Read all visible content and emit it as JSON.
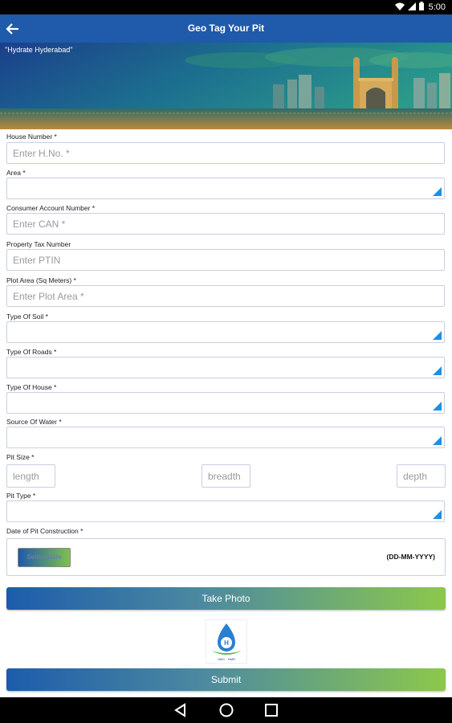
{
  "status": {
    "time": "5:00",
    "icons": [
      "wifi-icon",
      "signal-icon",
      "battery-icon"
    ]
  },
  "appbar": {
    "title": "Geo Tag Your Pit",
    "back_icon": "arrow-back-icon"
  },
  "banner": {
    "slogan": "\"Hydrate Hyderabad\""
  },
  "form": {
    "house_number": {
      "label": "House Number *",
      "placeholder": "Enter H.No. *"
    },
    "area": {
      "label": "Area *"
    },
    "can": {
      "label": "Consumer Account Number *",
      "placeholder": "Enter CAN *"
    },
    "ptin": {
      "label": "Property Tax Number",
      "placeholder": "Enter PTIN"
    },
    "plot_area": {
      "label": "Plot Area (Sq Meters) *",
      "placeholder": "Enter Plot Area *"
    },
    "soil": {
      "label": "Type Of Soil *"
    },
    "roads": {
      "label": "Type Of Roads *"
    },
    "house_type": {
      "label": "Type Of House *"
    },
    "water": {
      "label": "Source Of Water *"
    },
    "pit_size": {
      "label": "Pit Size *",
      "length": "length",
      "breadth": "breadth",
      "depth": "depth"
    },
    "pit_type": {
      "label": "Pit Type *"
    },
    "date": {
      "label": "Date of Pit Construction *",
      "button": "Select Date",
      "format": "(DD-MM-YYYY)"
    }
  },
  "actions": {
    "take_photo": "Take Photo",
    "submit": "Submit"
  },
  "logo": {
    "caption": "HMC · HMR"
  },
  "colors": {
    "primary": "#1f5aab",
    "accent_green": "#8cc84b",
    "dropdown_arrow": "#1f8fe0"
  }
}
